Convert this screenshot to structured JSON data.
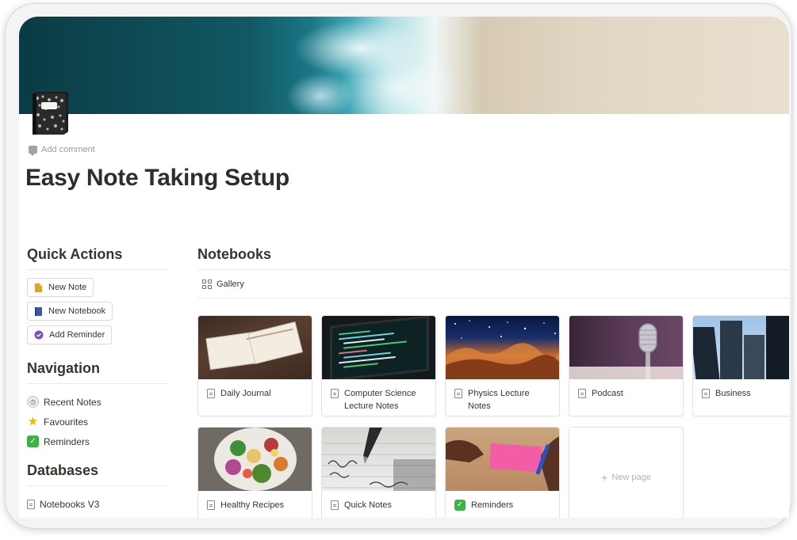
{
  "page": {
    "add_comment": "Add comment",
    "title": "Easy Note Taking Setup"
  },
  "quick_actions": {
    "heading": "Quick Actions",
    "buttons": [
      {
        "label": "New Note",
        "icon": "note-icon",
        "color": "#e0a030"
      },
      {
        "label": "New Notebook",
        "icon": "notebook-icon",
        "color": "#3e5a9c"
      },
      {
        "label": "Add Reminder",
        "icon": "reminder-check-icon",
        "color": "#7c4fbf"
      }
    ]
  },
  "navigation": {
    "heading": "Navigation",
    "items": [
      {
        "label": "Recent Notes",
        "icon": "clock-icon"
      },
      {
        "label": "Favourites",
        "icon": "star-icon"
      },
      {
        "label": "Reminders",
        "icon": "check-icon"
      }
    ]
  },
  "databases": {
    "heading": "Databases",
    "items": [
      {
        "label": "Notebooks V3",
        "icon": "page-icon"
      }
    ]
  },
  "notebooks": {
    "heading": "Notebooks",
    "view_label": "Gallery",
    "cards": [
      {
        "label": "Daily Journal",
        "icon": "page-icon",
        "image": "open-journal"
      },
      {
        "label": "Computer Science Lecture Notes",
        "icon": "page-icon",
        "image": "laptop-code"
      },
      {
        "label": "Physics Lecture Notes",
        "icon": "page-icon",
        "image": "nebula"
      },
      {
        "label": "Podcast",
        "icon": "page-icon",
        "image": "microphone"
      },
      {
        "label": "Business",
        "icon": "page-icon",
        "image": "skyscrapers"
      },
      {
        "label": "Healthy Recipes",
        "icon": "page-icon",
        "image": "salad-bowl"
      },
      {
        "label": "Quick Notes",
        "icon": "page-icon",
        "image": "pen-writing"
      },
      {
        "label": "Reminders",
        "icon": "check-icon",
        "image": "todo-sticky"
      }
    ],
    "new_page_label": "New page"
  },
  "colors": {
    "text": "#37352f",
    "muted": "#9b9a97",
    "border": "#e9e9e7",
    "check_green": "#3db346"
  }
}
